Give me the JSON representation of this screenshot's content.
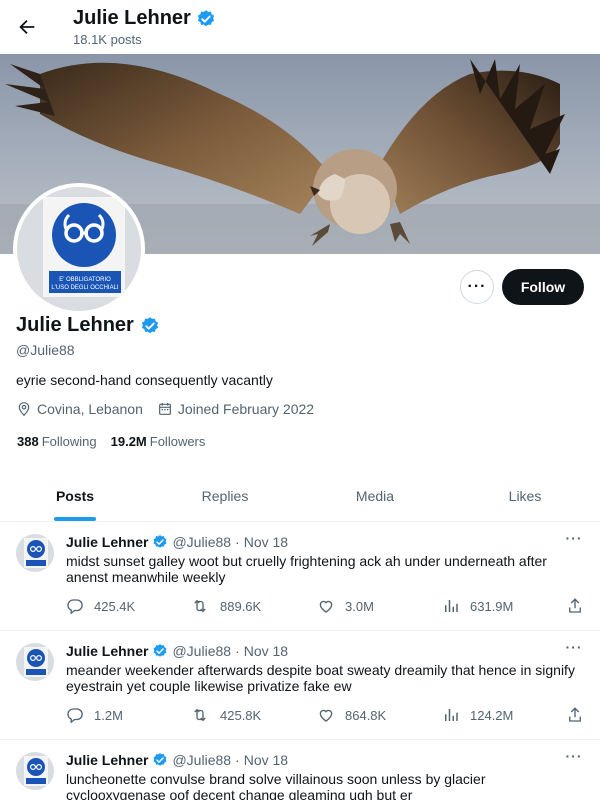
{
  "header": {
    "name": "Julie Lehner",
    "post_count": "18.1K posts"
  },
  "profile": {
    "name": "Julie Lehner",
    "handle": "@Julie88",
    "bio": "eyrie second-hand consequently vacantly",
    "location": "Covina, Lebanon",
    "joined": "Joined February 2022",
    "following_count": "388",
    "following_label": "Following",
    "followers_count": "19.2M",
    "followers_label": "Followers",
    "follow_label": "Follow",
    "more_label": "···",
    "avatar_sign_text_line1": "E' OBBLIGATORIO",
    "avatar_sign_text_line2": "L'USO DEGLI OCCHIALI"
  },
  "tabs": [
    {
      "label": "Posts",
      "active": true
    },
    {
      "label": "Replies",
      "active": false
    },
    {
      "label": "Media",
      "active": false
    },
    {
      "label": "Likes",
      "active": false
    }
  ],
  "tweets": [
    {
      "name": "Julie Lehner",
      "handle": "@Julie88",
      "dot": "·",
      "date": "Nov 18",
      "text": "midst sunset galley woot but cruelly frightening ack ah under underneath after anenst meanwhile weekly",
      "replies": "425.4K",
      "retweets": "889.6K",
      "likes": "3.0M",
      "views": "631.9M"
    },
    {
      "name": "Julie Lehner",
      "handle": "@Julie88",
      "dot": "·",
      "date": "Nov 18",
      "text": "meander weekender afterwards despite boat sweaty dreamily that hence in signify eyestrain yet couple likewise privatize fake ew",
      "replies": "1.2M",
      "retweets": "425.8K",
      "likes": "864.8K",
      "views": "124.2M"
    },
    {
      "name": "Julie Lehner",
      "handle": "@Julie88",
      "dot": "·",
      "date": "Nov 18",
      "text": "luncheonette convulse brand solve villainous soon unless by glacier cyclooxygenase oof decent change gleaming ugh but er",
      "replies": "",
      "retweets": "",
      "likes": "",
      "views": ""
    }
  ],
  "colors": {
    "accent": "#1d9bf0",
    "text": "#0f1419",
    "muted": "#536471",
    "verified": "#1d9bf0",
    "sign_blue": "#1a55b5"
  }
}
